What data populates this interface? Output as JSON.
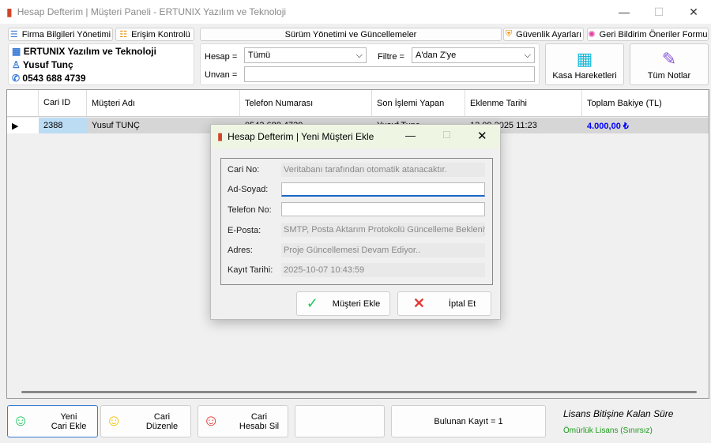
{
  "window": {
    "title": "Hesap Defterim | Müşteri Paneli - ERTUNIX Yazılım ve Teknoloji"
  },
  "toolbar": {
    "firma": "Firma Bilgileri Yönetimi",
    "erisim": "Erişim Kontrolü",
    "surum": "Sürüm Yönetimi ve Güncellemeler",
    "guvenlik": "Güvenlik Ayarları",
    "geri": "Geri Bildirim  Öneriler Formu"
  },
  "info": {
    "company": "ERTUNIX Yazılım ve Teknoloji",
    "user": "Yusuf Tunç",
    "phone": "0543 688 4739"
  },
  "filters": {
    "hesap_label": "Hesap  =",
    "hesap_value": "Tümü",
    "filtre_label": "Filtre  =",
    "filtre_value": "A'dan Z'ye",
    "unvan_label": "Unvan  =",
    "unvan_value": ""
  },
  "actions": {
    "kasa": "Kasa Hareketleri",
    "notlar": "Tüm Notlar"
  },
  "grid": {
    "columns": [
      "Cari ID",
      "Müşteri Adı",
      "Telefon Numarası",
      "Son İşlemi Yapan",
      "Eklenme Tarihi",
      "Toplam Bakiye (TL)"
    ],
    "rows": [
      {
        "id": "2388",
        "name": "Yusuf TUNÇ",
        "phone": "0543 688 4739",
        "by": "Yusuf Tunç",
        "date": "12.09.2025 11:23",
        "balance": "4.000,00 ₺"
      }
    ]
  },
  "bottom": {
    "yeni": "Yeni\nCari Ekle",
    "duzenle": "Cari\nDüzenle",
    "sil": "Cari\nHesabı Sil",
    "kayit": "Bulunan Kayıt = 1",
    "lisans_title": "Lisans Bitişine Kalan Süre",
    "lisans_value": "Ömürlük Lisans (Sınırsız)"
  },
  "dialog": {
    "title": "Hesap Defterim | Yeni Müşteri Ekle",
    "fields": [
      {
        "label": "Cari No:",
        "value": "Veritabanı tarafından otomatik atanacaktır."
      },
      {
        "label": "Ad-Soyad:",
        "value": ""
      },
      {
        "label": "Telefon No:",
        "value": ""
      },
      {
        "label": "E-Posta:",
        "value": "SMTP, Posta Aktarım Protokolü Güncelleme Bekleniyor"
      },
      {
        "label": "Adres:",
        "value": "Proje Güncellemesi Devam Ediyor.."
      },
      {
        "label": "Kayıt Tarihi:",
        "value": "2025-10-07 10:43:59"
      }
    ],
    "ok": "Müşteri Ekle",
    "cancel": "İptal Et"
  },
  "colors": {
    "balance": "#0000ff",
    "license": "#1a9a1a",
    "dialog_title_bg": "#eef6e3"
  }
}
